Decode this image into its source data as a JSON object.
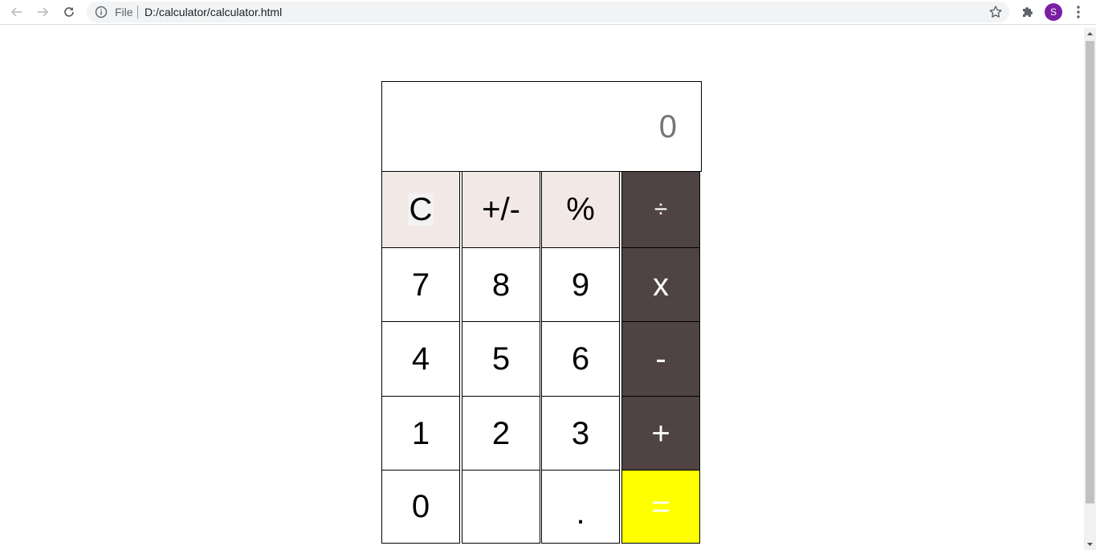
{
  "browser": {
    "back_icon": "arrow-left-icon",
    "forward_icon": "arrow-right-icon",
    "reload_icon": "reload-icon",
    "info_icon": "info-icon",
    "scheme_label": "File",
    "url": "D:/calculator/calculator.html",
    "bookmark_icon": "star-icon",
    "extensions_icon": "puzzle-icon",
    "profile_initial": "S",
    "menu_icon": "kebab-menu-icon"
  },
  "calculator": {
    "display": "0",
    "keys": {
      "clear": "C",
      "sign": "+/-",
      "percent": "%",
      "divide": "÷",
      "seven": "7",
      "eight": "8",
      "nine": "9",
      "multiply": "x",
      "four": "4",
      "five": "5",
      "six": "6",
      "minus": "-",
      "one": "1",
      "two": "2",
      "three": "3",
      "plus": "+",
      "zero": "0",
      "blank": "",
      "decimal": ".",
      "equals": "="
    }
  },
  "colors": {
    "function_key_bg": "#f2e9e7",
    "operator_key_bg": "#4f4443",
    "equals_key_bg": "#ffff00",
    "profile_avatar": "#7b1fa2"
  }
}
